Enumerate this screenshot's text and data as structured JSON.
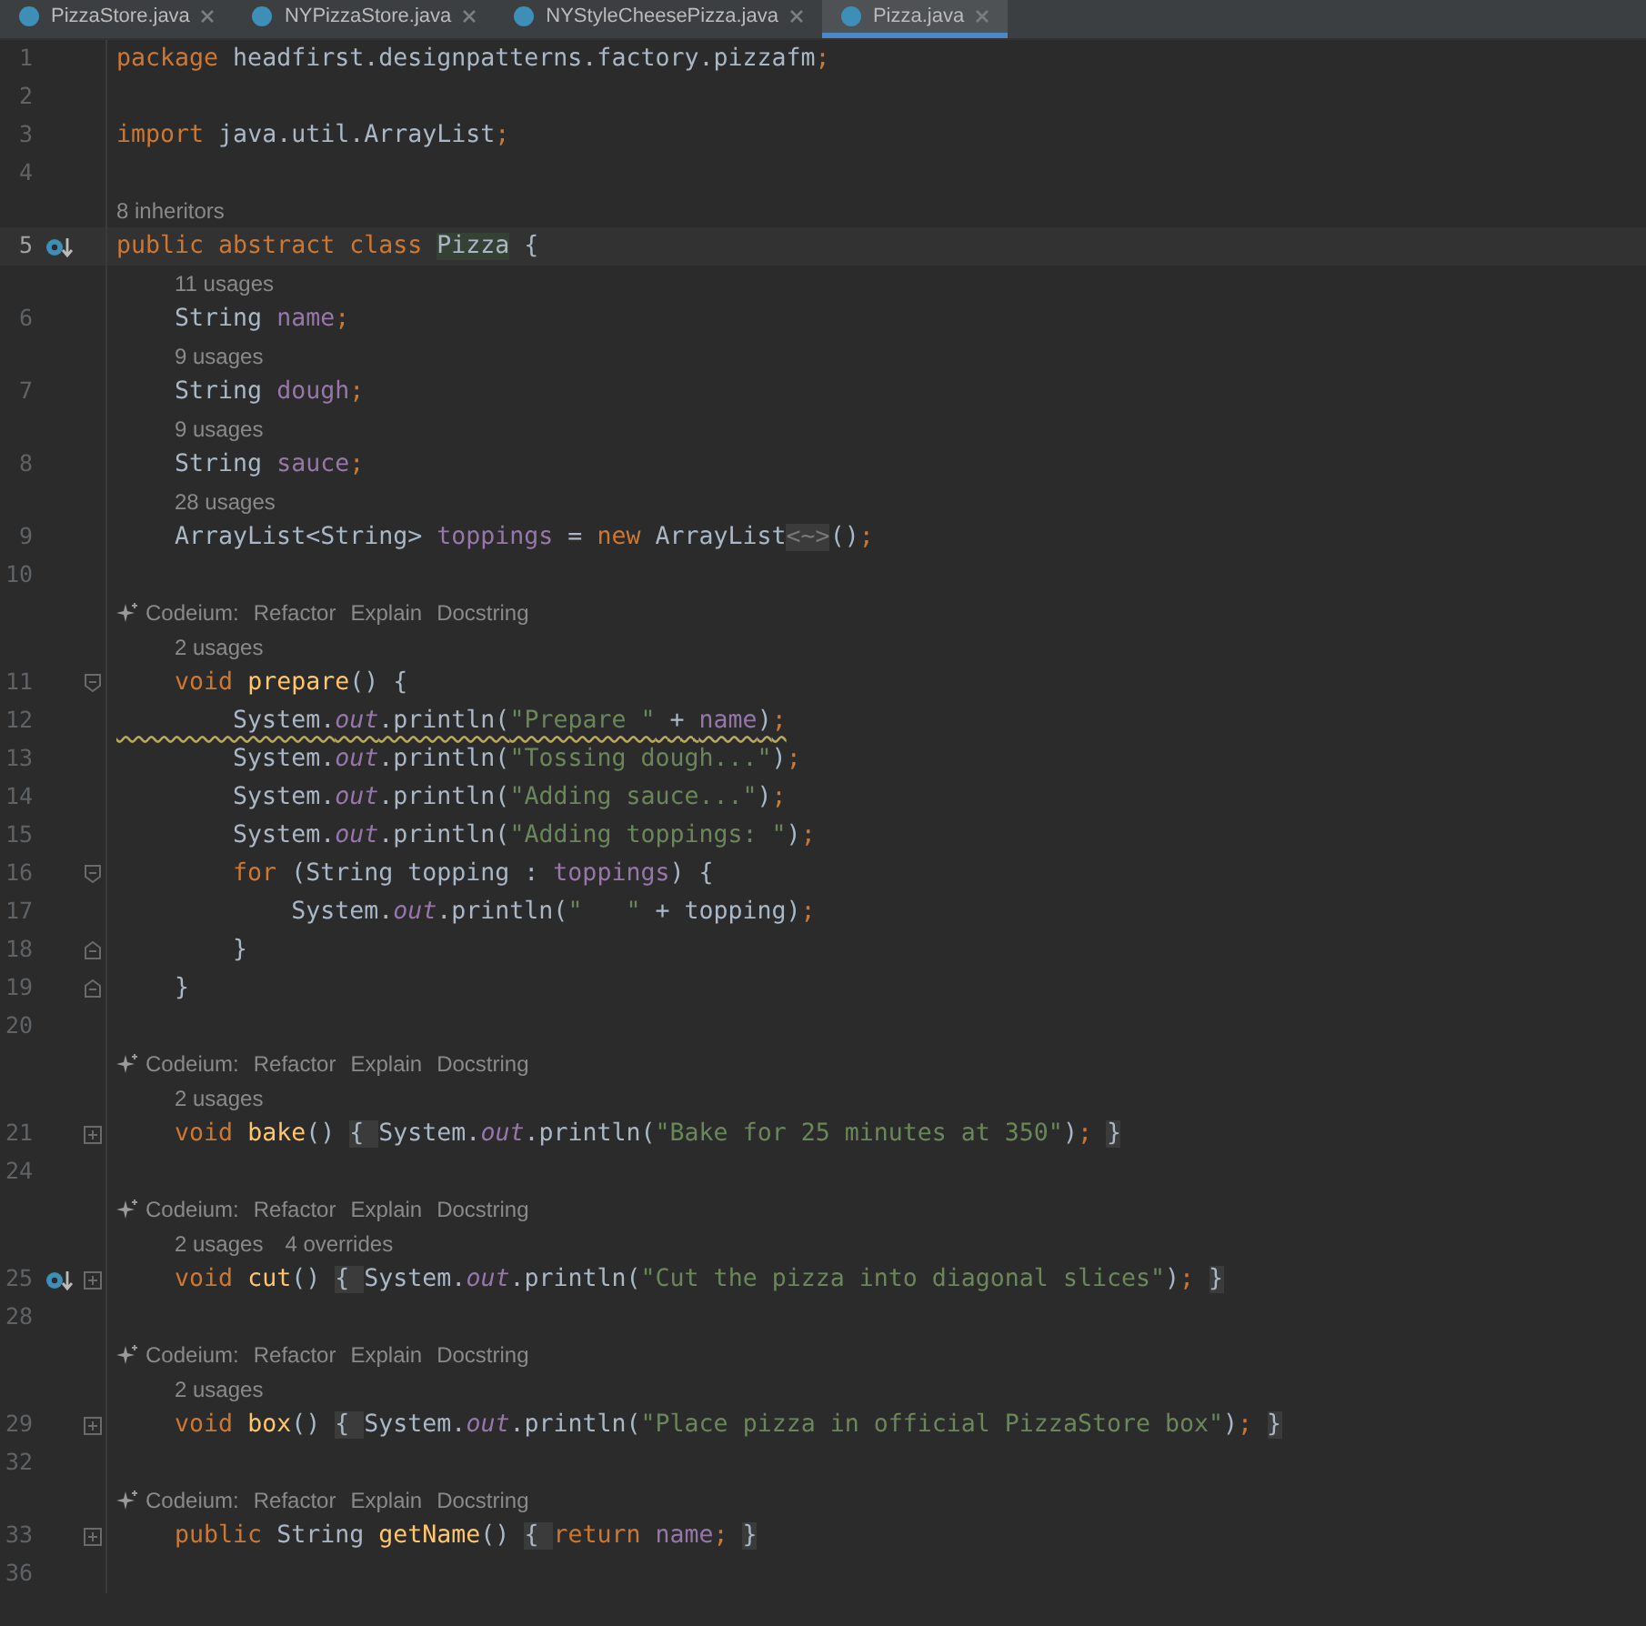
{
  "tabs": [
    {
      "label": "PizzaStore.java",
      "selected": false
    },
    {
      "label": "NYPizzaStore.java",
      "selected": false
    },
    {
      "label": "NYStyleCheesePizza.java",
      "selected": false
    },
    {
      "label": "Pizza.java",
      "selected": true
    }
  ],
  "lines": [
    {
      "kind": "code",
      "number": "1",
      "tokens": [
        {
          "kind": "keyword",
          "text": "package"
        },
        {
          "kind": "plain",
          "text": " headfirst.designpatterns.factory.pizzafm"
        },
        {
          "kind": "keyword",
          "text": ";"
        }
      ]
    },
    {
      "kind": "code",
      "number": "2"
    },
    {
      "kind": "code",
      "number": "3",
      "tokens": [
        {
          "kind": "keyword",
          "text": "import"
        },
        {
          "kind": "plain",
          "text": " java.util.ArrayList"
        },
        {
          "kind": "keyword",
          "text": ";"
        }
      ]
    },
    {
      "kind": "code",
      "number": "4"
    },
    {
      "kind": "usages",
      "items": [
        "8 inheritors"
      ]
    },
    {
      "kind": "code",
      "number": "5",
      "current": true,
      "marker": true,
      "tokens": [
        {
          "kind": "keyword",
          "text": "public abstract class "
        },
        {
          "kind": "declaration",
          "text": "Pizza"
        },
        {
          "kind": "plain",
          "text": " {"
        }
      ]
    },
    {
      "kind": "usages",
      "items": [
        "11 usages"
      ]
    },
    {
      "kind": "code",
      "number": "6",
      "tokens": [
        {
          "kind": "plain",
          "text": "    String "
        },
        {
          "kind": "field",
          "text": "name"
        },
        {
          "kind": "keyword",
          "text": ";"
        }
      ]
    },
    {
      "kind": "usages",
      "items": [
        "9 usages"
      ]
    },
    {
      "kind": "code",
      "number": "7",
      "tokens": [
        {
          "kind": "plain",
          "text": "    String "
        },
        {
          "kind": "field",
          "text": "dough"
        },
        {
          "kind": "keyword",
          "text": ";"
        }
      ]
    },
    {
      "kind": "usages",
      "items": [
        "9 usages"
      ]
    },
    {
      "kind": "code",
      "number": "8",
      "tokens": [
        {
          "kind": "plain",
          "text": "    String "
        },
        {
          "kind": "field",
          "text": "sauce"
        },
        {
          "kind": "keyword",
          "text": ";"
        }
      ]
    },
    {
      "kind": "usages",
      "items": [
        "28 usages"
      ]
    },
    {
      "kind": "code",
      "number": "9",
      "tokens": [
        {
          "kind": "plain",
          "text": "    ArrayList<String> "
        },
        {
          "kind": "field",
          "text": "toppings"
        },
        {
          "kind": "plain",
          "text": " = "
        },
        {
          "kind": "keyword",
          "text": "new"
        },
        {
          "kind": "plain",
          "text": " ArrayList"
        },
        {
          "kind": "inlay",
          "text": "<~>"
        },
        {
          "kind": "plain",
          "text": "()"
        },
        {
          "kind": "keyword",
          "text": ";"
        }
      ]
    },
    {
      "kind": "code",
      "number": "10"
    },
    {
      "kind": "codeium",
      "label": "Codeium:",
      "actions": [
        "Refactor",
        "Explain",
        "Docstring"
      ]
    },
    {
      "kind": "usages",
      "items": [
        "2 usages"
      ]
    },
    {
      "kind": "code",
      "number": "11",
      "fold_start": true,
      "tokens": [
        {
          "kind": "keyword",
          "text": "    void "
        },
        {
          "kind": "method",
          "text": "prepare"
        },
        {
          "kind": "plain",
          "text": "() {"
        }
      ]
    },
    {
      "kind": "code",
      "number": "12",
      "warning": true,
      "tokens": [
        {
          "kind": "plain",
          "text": "        System."
        },
        {
          "kind": "static",
          "text": "out"
        },
        {
          "kind": "plain",
          "text": ".println("
        },
        {
          "kind": "string",
          "text": "\"Prepare \""
        },
        {
          "kind": "plain",
          "text": " + "
        },
        {
          "kind": "field",
          "text": "name"
        },
        {
          "kind": "plain",
          "text": ")"
        },
        {
          "kind": "keyword",
          "text": ";"
        }
      ]
    },
    {
      "kind": "code",
      "number": "13",
      "tokens": [
        {
          "kind": "plain",
          "text": "        System."
        },
        {
          "kind": "static",
          "text": "out"
        },
        {
          "kind": "plain",
          "text": ".println("
        },
        {
          "kind": "string",
          "text": "\"Tossing dough...\""
        },
        {
          "kind": "plain",
          "text": ")"
        },
        {
          "kind": "keyword",
          "text": ";"
        }
      ]
    },
    {
      "kind": "code",
      "number": "14",
      "tokens": [
        {
          "kind": "plain",
          "text": "        System."
        },
        {
          "kind": "static",
          "text": "out"
        },
        {
          "kind": "plain",
          "text": ".println("
        },
        {
          "kind": "string",
          "text": "\"Adding sauce...\""
        },
        {
          "kind": "plain",
          "text": ")"
        },
        {
          "kind": "keyword",
          "text": ";"
        }
      ]
    },
    {
      "kind": "code",
      "number": "15",
      "tokens": [
        {
          "kind": "plain",
          "text": "        System."
        },
        {
          "kind": "static",
          "text": "out"
        },
        {
          "kind": "plain",
          "text": ".println("
        },
        {
          "kind": "string",
          "text": "\"Adding toppings: \""
        },
        {
          "kind": "plain",
          "text": ")"
        },
        {
          "kind": "keyword",
          "text": ";"
        }
      ]
    },
    {
      "kind": "code",
      "number": "16",
      "fold_start": true,
      "tokens": [
        {
          "kind": "keyword",
          "text": "        for"
        },
        {
          "kind": "plain",
          "text": " (String topping : "
        },
        {
          "kind": "field",
          "text": "toppings"
        },
        {
          "kind": "plain",
          "text": ") {"
        }
      ]
    },
    {
      "kind": "code",
      "number": "17",
      "tokens": [
        {
          "kind": "plain",
          "text": "            System."
        },
        {
          "kind": "static",
          "text": "out"
        },
        {
          "kind": "plain",
          "text": ".println("
        },
        {
          "kind": "string",
          "text": "\"   \""
        },
        {
          "kind": "plain",
          "text": " + topping)"
        },
        {
          "kind": "keyword",
          "text": ";"
        }
      ]
    },
    {
      "kind": "code",
      "number": "18",
      "fold_end": true,
      "tokens": [
        {
          "kind": "plain",
          "text": "        }"
        }
      ]
    },
    {
      "kind": "code",
      "number": "19",
      "fold_end": true,
      "tokens": [
        {
          "kind": "plain",
          "text": "    }"
        }
      ]
    },
    {
      "kind": "code",
      "number": "20"
    },
    {
      "kind": "codeium",
      "label": "Codeium:",
      "actions": [
        "Refactor",
        "Explain",
        "Docstring"
      ]
    },
    {
      "kind": "usages",
      "items": [
        "2 usages"
      ]
    },
    {
      "kind": "code",
      "number": "21",
      "collapsed": true,
      "tokens": [
        {
          "kind": "keyword",
          "text": "    void "
        },
        {
          "kind": "method",
          "text": "bake"
        },
        {
          "kind": "plain",
          "text": "() "
        },
        {
          "kind": "folded",
          "text": "{ "
        },
        {
          "kind": "plain",
          "text": "System."
        },
        {
          "kind": "static",
          "text": "out"
        },
        {
          "kind": "plain",
          "text": ".println("
        },
        {
          "kind": "string",
          "text": "\"Bake for 25 minutes at 350\""
        },
        {
          "kind": "plain",
          "text": ")"
        },
        {
          "kind": "keyword",
          "text": "; "
        },
        {
          "kind": "folded",
          "text": "}"
        }
      ]
    },
    {
      "kind": "code",
      "number": "24"
    },
    {
      "kind": "codeium",
      "label": "Codeium:",
      "actions": [
        "Refactor",
        "Explain",
        "Docstring"
      ]
    },
    {
      "kind": "usages",
      "items": [
        "2 usages",
        "4 overrides"
      ]
    },
    {
      "kind": "code",
      "number": "25",
      "marker": true,
      "collapsed": true,
      "tokens": [
        {
          "kind": "keyword",
          "text": "    void "
        },
        {
          "kind": "method",
          "text": "cut"
        },
        {
          "kind": "plain",
          "text": "() "
        },
        {
          "kind": "folded",
          "text": "{ "
        },
        {
          "kind": "plain",
          "text": "System."
        },
        {
          "kind": "static",
          "text": "out"
        },
        {
          "kind": "plain",
          "text": ".println("
        },
        {
          "kind": "string",
          "text": "\"Cut the pizza into diagonal slices\""
        },
        {
          "kind": "plain",
          "text": ")"
        },
        {
          "kind": "keyword",
          "text": "; "
        },
        {
          "kind": "folded",
          "text": "}"
        }
      ]
    },
    {
      "kind": "code",
      "number": "28"
    },
    {
      "kind": "codeium",
      "label": "Codeium:",
      "actions": [
        "Refactor",
        "Explain",
        "Docstring"
      ]
    },
    {
      "kind": "usages",
      "items": [
        "2 usages"
      ]
    },
    {
      "kind": "code",
      "number": "29",
      "collapsed": true,
      "tokens": [
        {
          "kind": "keyword",
          "text": "    void "
        },
        {
          "kind": "method",
          "text": "box"
        },
        {
          "kind": "plain",
          "text": "() "
        },
        {
          "kind": "folded",
          "text": "{ "
        },
        {
          "kind": "plain",
          "text": "System."
        },
        {
          "kind": "static",
          "text": "out"
        },
        {
          "kind": "plain",
          "text": ".println("
        },
        {
          "kind": "string",
          "text": "\"Place pizza in official PizzaStore box\""
        },
        {
          "kind": "plain",
          "text": ")"
        },
        {
          "kind": "keyword",
          "text": "; "
        },
        {
          "kind": "folded",
          "text": "}"
        }
      ]
    },
    {
      "kind": "code",
      "number": "32"
    },
    {
      "kind": "codeium",
      "label": "Codeium:",
      "actions": [
        "Refactor",
        "Explain",
        "Docstring"
      ]
    },
    {
      "kind": "code",
      "number": "33",
      "collapsed": true,
      "tokens": [
        {
          "kind": "keyword",
          "text": "    public"
        },
        {
          "kind": "plain",
          "text": " String "
        },
        {
          "kind": "method",
          "text": "getName"
        },
        {
          "kind": "plain",
          "text": "() "
        },
        {
          "kind": "folded",
          "text": "{ "
        },
        {
          "kind": "keyword",
          "text": "return"
        },
        {
          "kind": "field",
          "text": " name"
        },
        {
          "kind": "keyword",
          "text": "; "
        },
        {
          "kind": "folded",
          "text": "}"
        }
      ]
    },
    {
      "kind": "code",
      "number": "36"
    }
  ]
}
